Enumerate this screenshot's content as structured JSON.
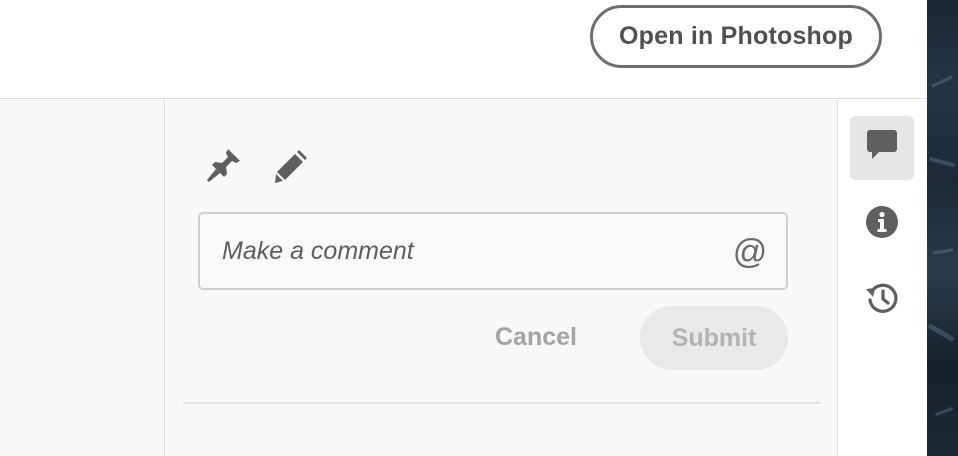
{
  "header": {
    "open_in_photoshop_label": "Open in Photoshop"
  },
  "comment_panel": {
    "tools": [
      {
        "icon": "pin-icon",
        "label": ""
      },
      {
        "icon": "pencil-icon",
        "label": ""
      }
    ],
    "input": {
      "placeholder": "Make a comment",
      "value": "",
      "mention_symbol": "@"
    },
    "cancel_label": "Cancel",
    "submit_label": "Submit"
  },
  "right_rail": {
    "items": [
      {
        "icon": "comment-icon",
        "active": true
      },
      {
        "icon": "info-icon",
        "active": false
      },
      {
        "icon": "history-icon",
        "active": false
      }
    ]
  },
  "colors": {
    "icon_gray": "#5f5f5f",
    "button_border": "#6e6e6e",
    "submit_bg": "#e9e9e9",
    "submit_text": "#b3b3b3",
    "active_rail_bg": "#e6e6e6"
  }
}
